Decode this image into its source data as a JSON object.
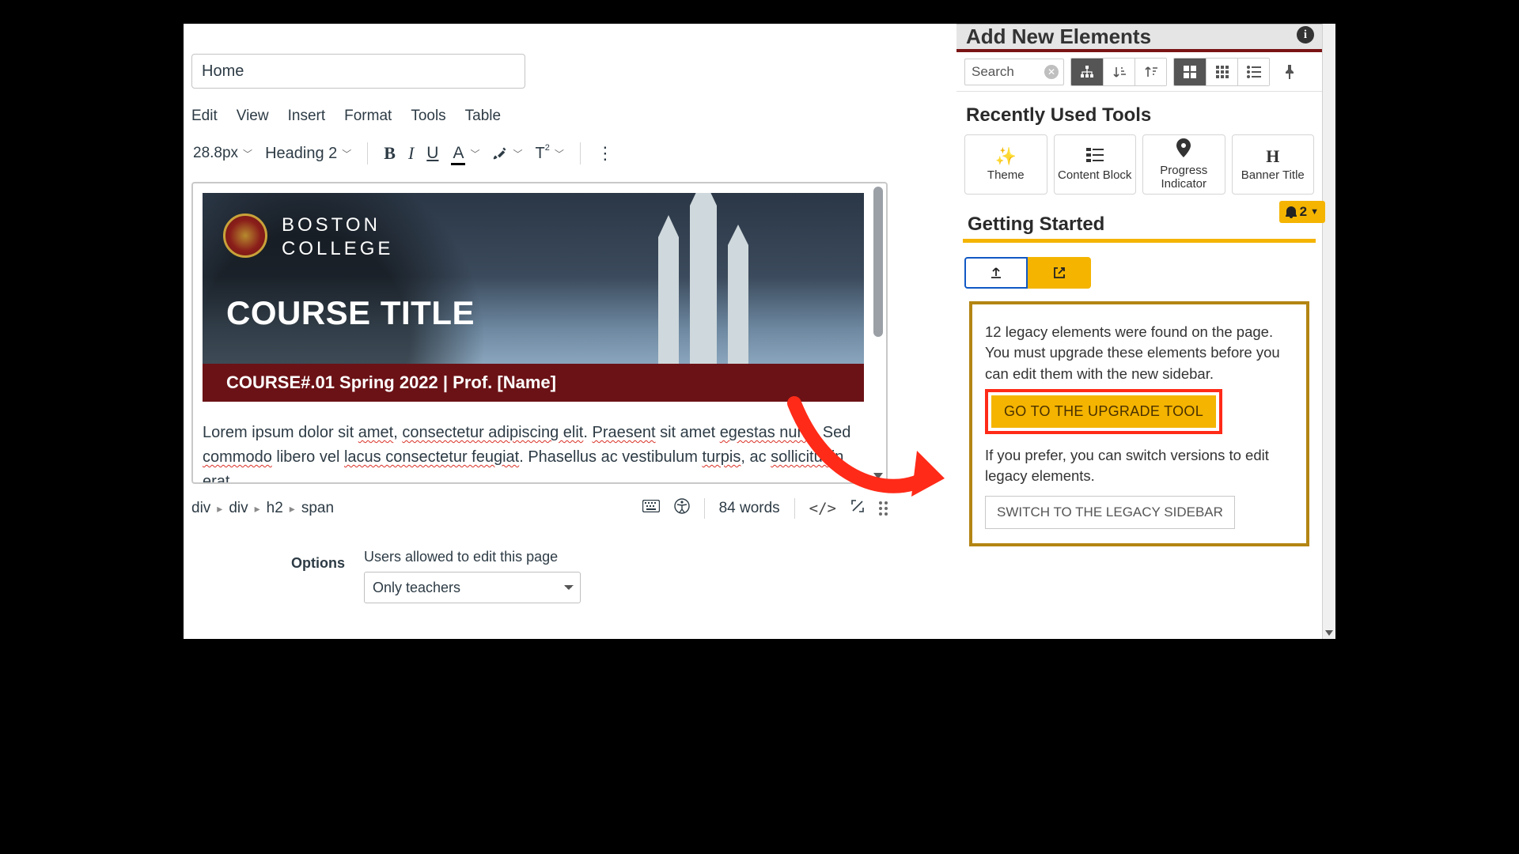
{
  "colors": {
    "maroon": "#6b1216",
    "gold": "#f4b400",
    "red": "#ff2a18"
  },
  "title_input": "Home",
  "menubar": [
    "Edit",
    "View",
    "Insert",
    "Format",
    "Tools",
    "Table"
  ],
  "toolbar": {
    "font_size": "28.8px",
    "block_type": "Heading 2"
  },
  "banner": {
    "institution_line1": "BOSTON",
    "institution_line2": "COLLEGE",
    "course_title": "COURSE TITLE",
    "subtitle": "COURSE#.01 Spring 2022 | Prof. [Name]"
  },
  "lorem": {
    "plain1": "Lorem ipsum dolor sit ",
    "sp1": "amet",
    "plain2": ", ",
    "sp2": "consectetur adipiscing elit",
    "plain3": ". ",
    "sp3": "Praesent",
    "plain4": " sit amet ",
    "sp4": "egestas nunc",
    "plain5": ". Sed ",
    "sp5": "commodo",
    "plain6": " libero vel ",
    "sp6": "lacus consectetur feugiat",
    "plain7": ". Phasellus ac vestibulum ",
    "sp7": "turpis",
    "plain8": ", ac ",
    "sp8": "sollicitudin erat",
    "plain9": "."
  },
  "statusbar": {
    "crumbs": [
      "div",
      "div",
      "h2",
      "span"
    ],
    "word_count": "84 words"
  },
  "options": {
    "label": "Options",
    "caption": "Users allowed to edit this page",
    "selected": "Only teachers"
  },
  "sidebar": {
    "header": "Add New Elements",
    "search_placeholder": "Search",
    "recent_heading": "Recently Used Tools",
    "tools": [
      {
        "label": "Theme"
      },
      {
        "label": "Content Block"
      },
      {
        "label": "Progress Indicator"
      },
      {
        "label": "Banner Title"
      }
    ],
    "getting_started": "Getting Started",
    "notif_count": "2",
    "callout_p1": "12 legacy elements were found on the page. You must upgrade these elements before you can edit them with the new sidebar.",
    "upgrade_btn": "GO TO THE UPGRADE TOOL",
    "callout_p2": "If you prefer, you can switch versions to edit legacy elements.",
    "legacy_btn": "SWITCH TO THE LEGACY SIDEBAR"
  }
}
